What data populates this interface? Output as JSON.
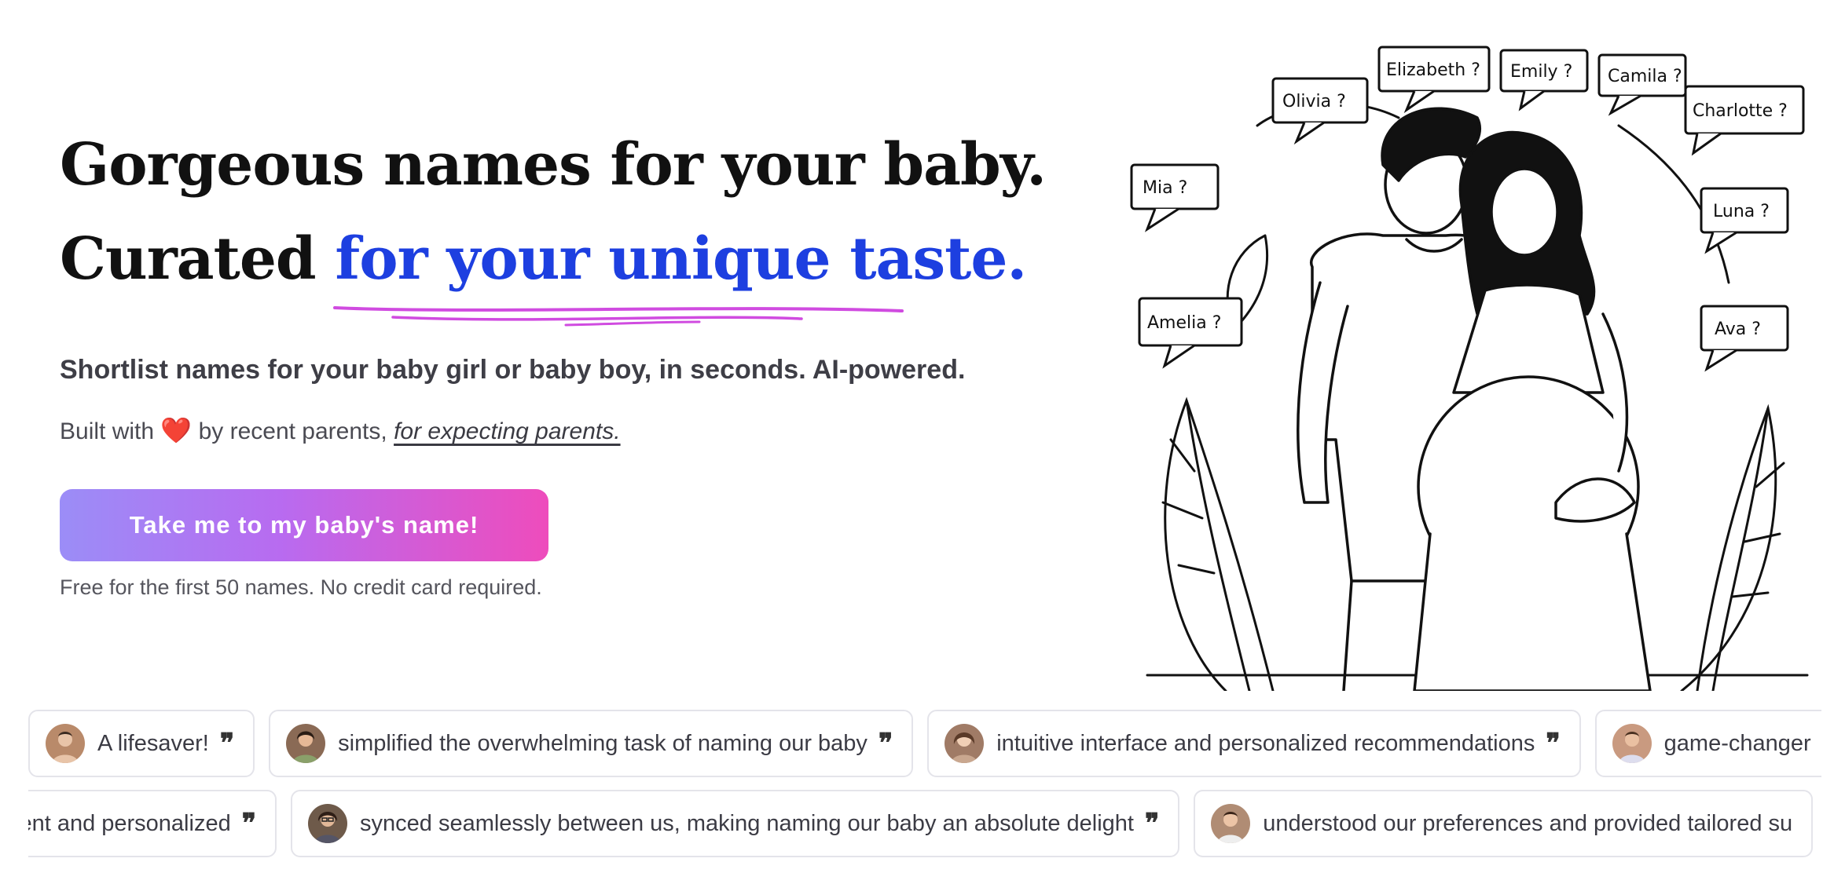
{
  "hero": {
    "headline_line1": "Gorgeous names for your baby.",
    "headline_line2_prefix": "Curated ",
    "headline_line2_accent": "for your unique taste.",
    "subhead": "Shortlist names for your baby girl or baby boy, in seconds. AI-powered.",
    "built_prefix": "Built with",
    "built_heart": "❤️",
    "built_middle": "by recent parents,",
    "built_link": "for expecting parents.",
    "cta_label": "Take me to my baby's name!",
    "free_note": "Free for the first 50 names. No credit card required."
  },
  "illustration": {
    "names": [
      "Olivia ?",
      "Elizabeth ?",
      "Emily ?",
      "Camila ?",
      "Charlotte ?",
      "Mia ?",
      "Luna ?",
      "Amelia ?",
      "Ava ?"
    ]
  },
  "testimonials_row1": [
    {
      "text": "A lifesaver!",
      "avatar_color": "#b98a6a"
    },
    {
      "text": "simplified the overwhelming task of naming our baby",
      "avatar_color": "#8a6a55"
    },
    {
      "text": "intuitive interface and personalized recommendations",
      "avatar_color": "#a07b66"
    },
    {
      "text": "game-changer",
      "avatar_color": "#c99a80"
    }
  ],
  "testimonials_row2": [
    {
      "text": "ient and personalized",
      "avatar_color": ""
    },
    {
      "text": "synced seamlessly between us, making naming our baby an absolute delight",
      "avatar_color": "#6e5a4a"
    },
    {
      "text": "understood our preferences and provided tailored su",
      "avatar_color": "#b08c74"
    }
  ],
  "quote_glyph": "❞",
  "colors": {
    "accent": "#1d3fe0",
    "cta_start": "#9b8df7",
    "cta_end": "#ee4cbc",
    "underline": "#d04be0"
  }
}
